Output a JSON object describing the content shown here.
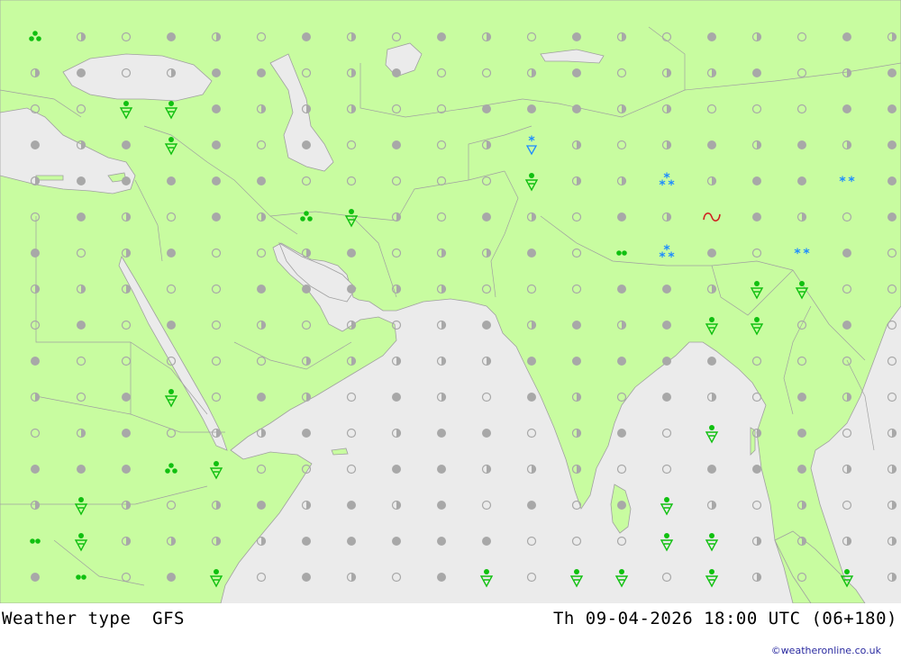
{
  "footer": {
    "title_left": "Weather type  GFS",
    "title_right": "Th 09-04-2026 18:00 UTC (06+180)",
    "credit": "©weatheronline.co.uk"
  },
  "colors": {
    "land": "#c8fca0",
    "sea": "#ebebeb",
    "border": "#a0a0a0",
    "dot_gray": "#a8a8a8",
    "rain_green": "#10c010",
    "snow_blue": "#1e8cff",
    "fog_red": "#d02020"
  },
  "legend_symbols": [
    "cloud-clear",
    "cloud-half",
    "overcast",
    "showers",
    "light-rain",
    "rain",
    "snow",
    "snow-shower",
    "fog"
  ]
}
